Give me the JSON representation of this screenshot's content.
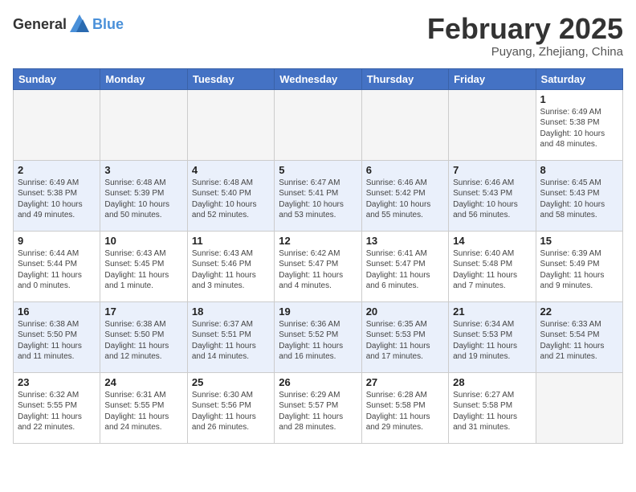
{
  "header": {
    "logo_general": "General",
    "logo_blue": "Blue",
    "month_title": "February 2025",
    "subtitle": "Puyang, Zhejiang, China"
  },
  "weekdays": [
    "Sunday",
    "Monday",
    "Tuesday",
    "Wednesday",
    "Thursday",
    "Friday",
    "Saturday"
  ],
  "weeks": [
    [
      {
        "day": "",
        "info": ""
      },
      {
        "day": "",
        "info": ""
      },
      {
        "day": "",
        "info": ""
      },
      {
        "day": "",
        "info": ""
      },
      {
        "day": "",
        "info": ""
      },
      {
        "day": "",
        "info": ""
      },
      {
        "day": "1",
        "info": "Sunrise: 6:49 AM\nSunset: 5:38 PM\nDaylight: 10 hours\nand 48 minutes."
      }
    ],
    [
      {
        "day": "2",
        "info": "Sunrise: 6:49 AM\nSunset: 5:38 PM\nDaylight: 10 hours\nand 49 minutes."
      },
      {
        "day": "3",
        "info": "Sunrise: 6:48 AM\nSunset: 5:39 PM\nDaylight: 10 hours\nand 50 minutes."
      },
      {
        "day": "4",
        "info": "Sunrise: 6:48 AM\nSunset: 5:40 PM\nDaylight: 10 hours\nand 52 minutes."
      },
      {
        "day": "5",
        "info": "Sunrise: 6:47 AM\nSunset: 5:41 PM\nDaylight: 10 hours\nand 53 minutes."
      },
      {
        "day": "6",
        "info": "Sunrise: 6:46 AM\nSunset: 5:42 PM\nDaylight: 10 hours\nand 55 minutes."
      },
      {
        "day": "7",
        "info": "Sunrise: 6:46 AM\nSunset: 5:43 PM\nDaylight: 10 hours\nand 56 minutes."
      },
      {
        "day": "8",
        "info": "Sunrise: 6:45 AM\nSunset: 5:43 PM\nDaylight: 10 hours\nand 58 minutes."
      }
    ],
    [
      {
        "day": "9",
        "info": "Sunrise: 6:44 AM\nSunset: 5:44 PM\nDaylight: 11 hours\nand 0 minutes."
      },
      {
        "day": "10",
        "info": "Sunrise: 6:43 AM\nSunset: 5:45 PM\nDaylight: 11 hours\nand 1 minute."
      },
      {
        "day": "11",
        "info": "Sunrise: 6:43 AM\nSunset: 5:46 PM\nDaylight: 11 hours\nand 3 minutes."
      },
      {
        "day": "12",
        "info": "Sunrise: 6:42 AM\nSunset: 5:47 PM\nDaylight: 11 hours\nand 4 minutes."
      },
      {
        "day": "13",
        "info": "Sunrise: 6:41 AM\nSunset: 5:47 PM\nDaylight: 11 hours\nand 6 minutes."
      },
      {
        "day": "14",
        "info": "Sunrise: 6:40 AM\nSunset: 5:48 PM\nDaylight: 11 hours\nand 7 minutes."
      },
      {
        "day": "15",
        "info": "Sunrise: 6:39 AM\nSunset: 5:49 PM\nDaylight: 11 hours\nand 9 minutes."
      }
    ],
    [
      {
        "day": "16",
        "info": "Sunrise: 6:38 AM\nSunset: 5:50 PM\nDaylight: 11 hours\nand 11 minutes."
      },
      {
        "day": "17",
        "info": "Sunrise: 6:38 AM\nSunset: 5:50 PM\nDaylight: 11 hours\nand 12 minutes."
      },
      {
        "day": "18",
        "info": "Sunrise: 6:37 AM\nSunset: 5:51 PM\nDaylight: 11 hours\nand 14 minutes."
      },
      {
        "day": "19",
        "info": "Sunrise: 6:36 AM\nSunset: 5:52 PM\nDaylight: 11 hours\nand 16 minutes."
      },
      {
        "day": "20",
        "info": "Sunrise: 6:35 AM\nSunset: 5:53 PM\nDaylight: 11 hours\nand 17 minutes."
      },
      {
        "day": "21",
        "info": "Sunrise: 6:34 AM\nSunset: 5:53 PM\nDaylight: 11 hours\nand 19 minutes."
      },
      {
        "day": "22",
        "info": "Sunrise: 6:33 AM\nSunset: 5:54 PM\nDaylight: 11 hours\nand 21 minutes."
      }
    ],
    [
      {
        "day": "23",
        "info": "Sunrise: 6:32 AM\nSunset: 5:55 PM\nDaylight: 11 hours\nand 22 minutes."
      },
      {
        "day": "24",
        "info": "Sunrise: 6:31 AM\nSunset: 5:55 PM\nDaylight: 11 hours\nand 24 minutes."
      },
      {
        "day": "25",
        "info": "Sunrise: 6:30 AM\nSunset: 5:56 PM\nDaylight: 11 hours\nand 26 minutes."
      },
      {
        "day": "26",
        "info": "Sunrise: 6:29 AM\nSunset: 5:57 PM\nDaylight: 11 hours\nand 28 minutes."
      },
      {
        "day": "27",
        "info": "Sunrise: 6:28 AM\nSunset: 5:58 PM\nDaylight: 11 hours\nand 29 minutes."
      },
      {
        "day": "28",
        "info": "Sunrise: 6:27 AM\nSunset: 5:58 PM\nDaylight: 11 hours\nand 31 minutes."
      },
      {
        "day": "",
        "info": ""
      }
    ]
  ]
}
